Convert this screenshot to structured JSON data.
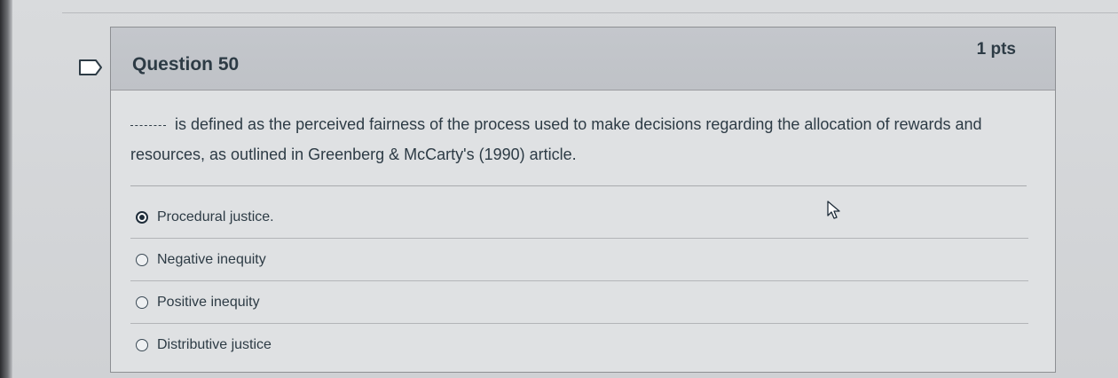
{
  "question": {
    "title": "Question 50",
    "points": "1 pts",
    "blank": "_____",
    "text": "is defined as the perceived fairness of the process used to make decisions regarding the allocation of rewards and resources, as outlined in Greenberg & McCarty's (1990) article."
  },
  "answers": [
    {
      "label": "Procedural justice.",
      "selected": true
    },
    {
      "label": "Negative inequity",
      "selected": false
    },
    {
      "label": "Positive inequity",
      "selected": false
    },
    {
      "label": "Distributive justice",
      "selected": false
    }
  ],
  "icons": {
    "flag": "flag-question-icon",
    "cursor": "mouse-pointer-icon"
  }
}
